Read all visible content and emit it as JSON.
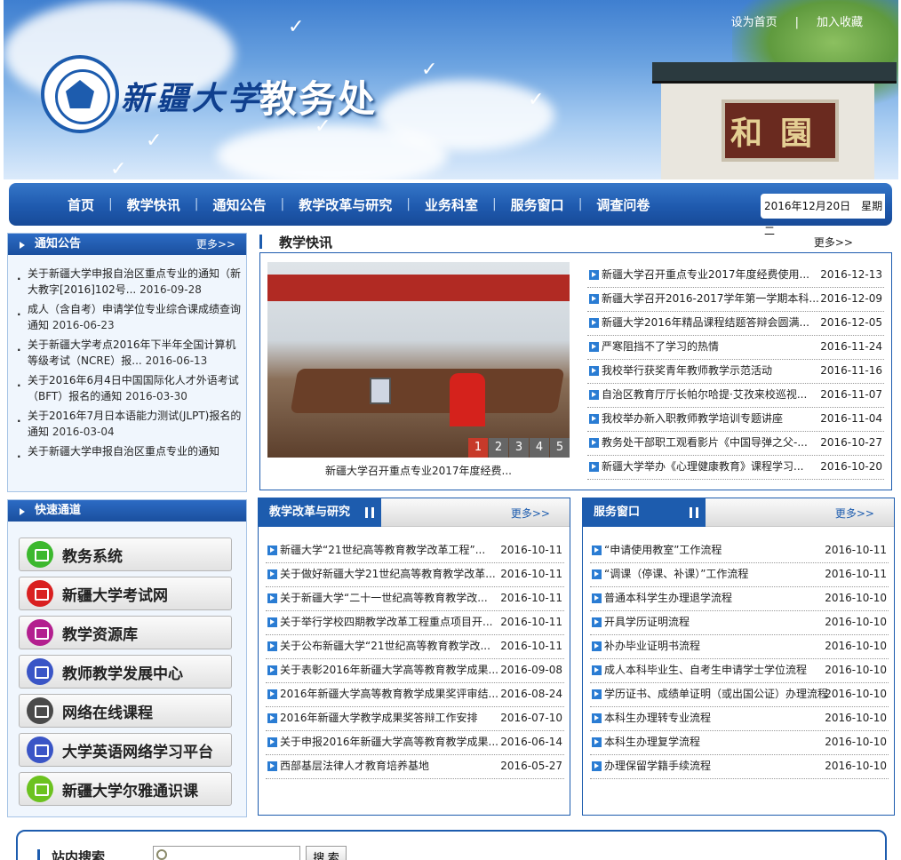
{
  "header": {
    "university": "新疆大学",
    "department": "教务处",
    "gate_text": "和園",
    "top_links": [
      "设为首页",
      "加入收藏"
    ],
    "top_sep": "|"
  },
  "nav": {
    "items": [
      "首页",
      "教学快讯",
      "通知公告",
      "教学改革与研究",
      "业务科室",
      "服务窗口",
      "调查问卷"
    ],
    "date": "2016年12月20日　星期二"
  },
  "notice": {
    "title": "通知公告",
    "more": "更多>>",
    "items": [
      {
        "text": "关于新疆大学申报自治区重点专业的通知（新大教字[2016]102号...",
        "date": "2016-09-28"
      },
      {
        "text": "成人（含自考）申请学位专业综合课成绩查询通知",
        "date": "2016-06-23"
      },
      {
        "text": "关于新疆大学考点2016年下半年全国计算机等级考试（NCRE）报...",
        "date": "2016-06-13"
      },
      {
        "text": "关于2016年6月4日中国国际化人才外语考试（BFT）报名的通知",
        "date": "2016-03-30"
      },
      {
        "text": "关于2016年7月日本语能力测试(JLPT)报名的通知",
        "date": "2016-03-04"
      },
      {
        "text": "关于新疆大学申报自治区重点专业的通知",
        "date": ""
      }
    ]
  },
  "quick": {
    "title": "快速通道",
    "items": [
      {
        "label": "教务系统",
        "color": "#3cb82e",
        "icon": "monitor-icon"
      },
      {
        "label": "新疆大学考试网",
        "color": "#d92020",
        "icon": "chart-icon"
      },
      {
        "label": "教学资源库",
        "color": "#b31f8f",
        "icon": "laptop-icon"
      },
      {
        "label": "教师教学发展中心",
        "color": "#3a55c6",
        "icon": "video-icon"
      },
      {
        "label": "网络在线课程",
        "color": "#4a4a4a",
        "icon": "online-course-icon"
      },
      {
        "label": "大学英语网络学习平台",
        "color": "#3a55c6",
        "icon": "edit-icon"
      },
      {
        "label": "新疆大学尔雅通识课",
        "color": "#6cc21f",
        "icon": "headphones-icon"
      }
    ]
  },
  "news": {
    "title": "教学快讯",
    "more": "更多>>",
    "caption": "新疆大学召开重点专业2017年度经费...",
    "pages": [
      "1",
      "2",
      "3",
      "4",
      "5"
    ],
    "active_page": "1",
    "items": [
      {
        "text": "新疆大学召开重点专业2017年度经费使用...",
        "date": "2016-12-13"
      },
      {
        "text": "新疆大学召开2016-2017学年第一学期本科...",
        "date": "2016-12-09"
      },
      {
        "text": "新疆大学2016年精品课程结题答辩会圆满...",
        "date": "2016-12-05"
      },
      {
        "text": "严寒阻挡不了学习的热情",
        "date": "2016-11-24"
      },
      {
        "text": "我校举行获奖青年教师教学示范活动",
        "date": "2016-11-16"
      },
      {
        "text": "自治区教育厅厅长帕尔哈提·艾孜来校巡视...",
        "date": "2016-11-07"
      },
      {
        "text": "我校举办新入职教师教学培训专题讲座",
        "date": "2016-11-04"
      },
      {
        "text": "教务处干部职工观看影片《中国导弹之父-...",
        "date": "2016-10-27"
      },
      {
        "text": "新疆大学举办《心理健康教育》课程学习...",
        "date": "2016-10-20"
      }
    ]
  },
  "reform": {
    "title": "教学改革与研究",
    "more": "更多>>",
    "items": [
      {
        "text": "新疆大学“21世纪高等教育教学改革工程”...",
        "date": "2016-10-11"
      },
      {
        "text": "关于做好新疆大学21世纪高等教育教学改革...",
        "date": "2016-10-11"
      },
      {
        "text": "关于新疆大学“二十一世纪高等教育教学改...",
        "date": "2016-10-11"
      },
      {
        "text": "关于举行学校四期教学改革工程重点项目开...",
        "date": "2016-10-11"
      },
      {
        "text": "关于公布新疆大学“21世纪高等教育教学改...",
        "date": "2016-10-11"
      },
      {
        "text": "关于表彰2016年新疆大学高等教育教学成果...",
        "date": "2016-09-08"
      },
      {
        "text": "2016年新疆大学高等教育教学成果奖评审结...",
        "date": "2016-08-24"
      },
      {
        "text": "2016年新疆大学教学成果奖答辩工作安排",
        "date": "2016-07-10"
      },
      {
        "text": "关于申报2016年新疆大学高等教育教学成果...",
        "date": "2016-06-14"
      },
      {
        "text": "西部基层法律人才教育培养基地",
        "date": "2016-05-27"
      }
    ]
  },
  "service": {
    "title": "服务窗口",
    "more": "更多>>",
    "items": [
      {
        "text": "“申请使用教室”工作流程",
        "date": "2016-10-11"
      },
      {
        "text": "“调课（停课、补课）”工作流程",
        "date": "2016-10-11"
      },
      {
        "text": "普通本科学生办理退学流程",
        "date": "2016-10-10"
      },
      {
        "text": "开具学历证明流程",
        "date": "2016-10-10"
      },
      {
        "text": "补办毕业证明书流程",
        "date": "2016-10-10"
      },
      {
        "text": "成人本科毕业生、自考生申请学士学位流程",
        "date": "2016-10-10"
      },
      {
        "text": "学历证书、成绩单证明（或出国公证）办理流程",
        "date": "2016-10-10"
      },
      {
        "text": "本科生办理转专业流程",
        "date": "2016-10-10"
      },
      {
        "text": "本科生办理复学流程",
        "date": "2016-10-10"
      },
      {
        "text": "办理保留学籍手续流程",
        "date": "2016-10-10"
      }
    ]
  },
  "search": {
    "label": "站内搜索",
    "button": "搜 索",
    "placeholder": ""
  }
}
